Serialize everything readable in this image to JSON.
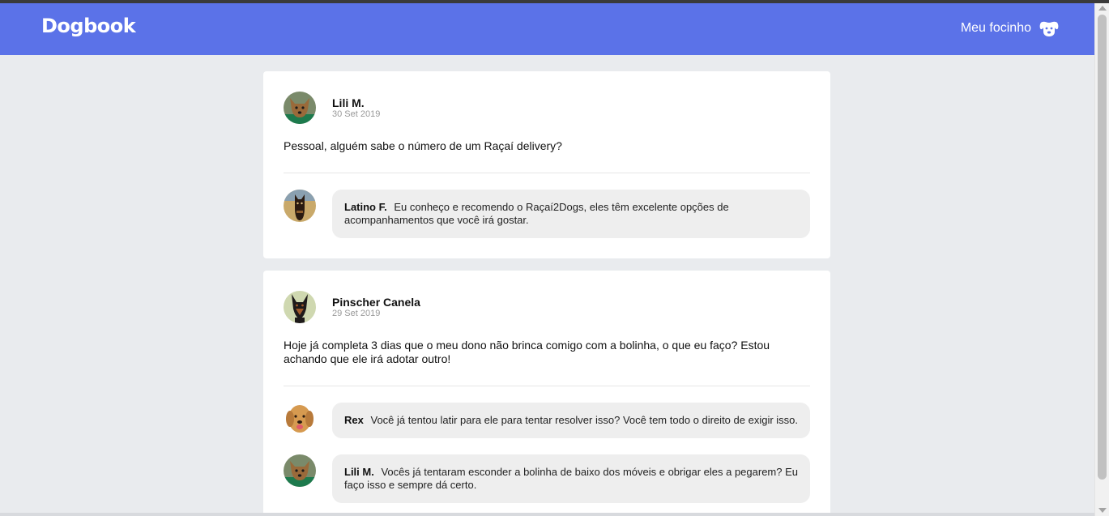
{
  "navbar": {
    "brand": "Dogbook",
    "profile_label": "Meu focinho",
    "profile_icon": "dog-face-icon",
    "background": "#5b72e8"
  },
  "posts": [
    {
      "author": "Lili M.",
      "date": "30 Set 2019",
      "avatar": "avatar-lili",
      "content": "Pessoal, alguém sabe o número de um Raçaí delivery?",
      "comments": [
        {
          "author": "Latino F.",
          "avatar": "avatar-latino",
          "text": "Eu conheço e recomendo o Raçaí2Dogs, eles têm excelente opções de acompanhamentos que você irá gostar."
        }
      ]
    },
    {
      "author": "Pinscher Canela",
      "date": "29 Set 2019",
      "avatar": "avatar-pinscher",
      "content": "Hoje já completa 3 dias que o meu dono não brinca comigo com a bolinha, o que eu faço? Estou achando que ele irá adotar outro!",
      "comments": [
        {
          "author": "Rex",
          "avatar": "avatar-rex",
          "text": "Você já tentou latir para ele para tentar resolver isso? Você tem todo o direito de exigir isso."
        },
        {
          "author": "Lili M.",
          "avatar": "avatar-lili",
          "text": "Vocês já tentaram esconder a bolinha de baixo dos móveis e obrigar eles a pegarem? Eu faço isso e sempre dá certo."
        }
      ]
    }
  ]
}
